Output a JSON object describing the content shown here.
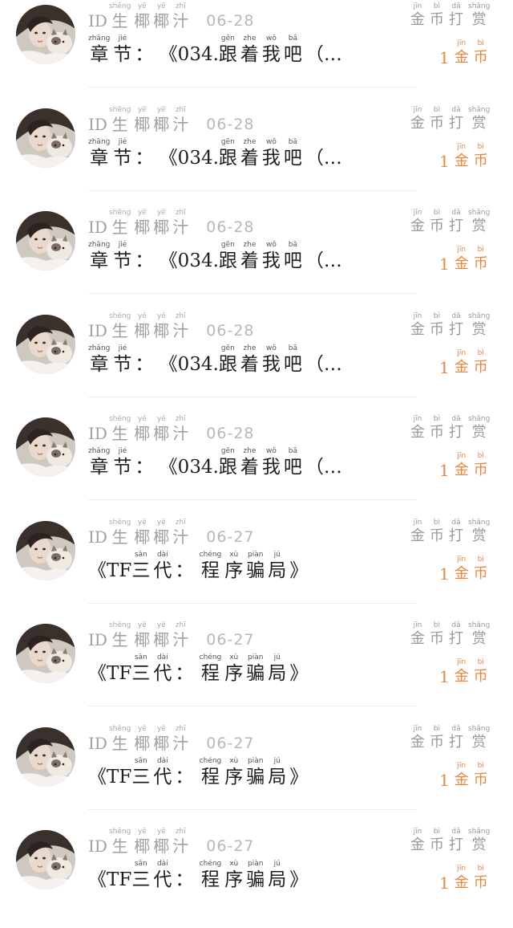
{
  "colors": {
    "background": "#ffffff",
    "meta_text": "#a0a0a0",
    "content_text": "#1e1e1e",
    "coin_accent": "#e8863f",
    "divider": "#ececec"
  },
  "icons": {
    "avatar": "user-avatar-photo"
  },
  "reward_label": {
    "chars": [
      {
        "py": "jīn",
        "hz": "金"
      },
      {
        "py": "bì",
        "hz": "币"
      },
      {
        "py": "dǎ",
        "hz": "打"
      },
      {
        "py": "shǎng",
        "hz": "赏"
      }
    ]
  },
  "cost_label": {
    "amount": "1",
    "chars": [
      {
        "py": "jīn",
        "hz": "金"
      },
      {
        "py": "bì",
        "hz": "币"
      }
    ]
  },
  "username": {
    "prefix": "ID",
    "chars": [
      {
        "py": "shēng",
        "hz": "生"
      },
      {
        "py": "yē",
        "hz": "椰"
      },
      {
        "py": "yē",
        "hz": "椰"
      },
      {
        "py": "zhī",
        "hz": "汁"
      }
    ]
  },
  "content_types": {
    "chapter": [
      {
        "py": "zhāng",
        "hz": "章"
      },
      {
        "py": "jié",
        "hz": "节"
      },
      {
        "plain": "： 《034."
      },
      {
        "py": "gēn",
        "hz": "跟"
      },
      {
        "py": "zhe",
        "hz": "着"
      },
      {
        "py": "wǒ",
        "hz": "我"
      },
      {
        "py": "bā",
        "hz": "吧"
      },
      {
        "plain": "（…"
      }
    ],
    "work": [
      {
        "plain": "《TF"
      },
      {
        "py": "sān",
        "hz": "三"
      },
      {
        "py": "dài",
        "hz": "代"
      },
      {
        "plain": "： "
      },
      {
        "py": "chéng",
        "hz": "程"
      },
      {
        "py": "xù",
        "hz": "序"
      },
      {
        "py": "piàn",
        "hz": "骗"
      },
      {
        "py": "jú",
        "hz": "局"
      },
      {
        "plain": "》"
      }
    ]
  },
  "rows": [
    {
      "date": "06-28",
      "content": "chapter"
    },
    {
      "date": "06-28",
      "content": "chapter"
    },
    {
      "date": "06-28",
      "content": "chapter"
    },
    {
      "date": "06-28",
      "content": "chapter"
    },
    {
      "date": "06-28",
      "content": "chapter"
    },
    {
      "date": "06-27",
      "content": "work"
    },
    {
      "date": "06-27",
      "content": "work"
    },
    {
      "date": "06-27",
      "content": "work"
    },
    {
      "date": "06-27",
      "content": "work"
    }
  ]
}
